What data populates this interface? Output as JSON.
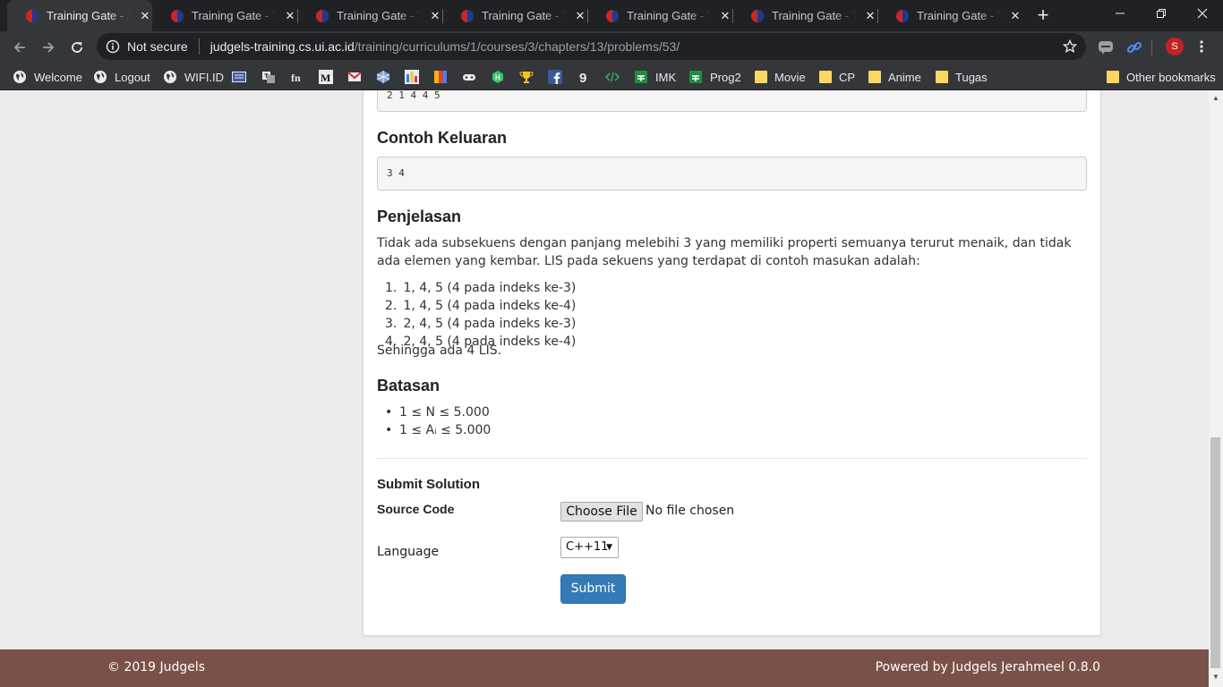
{
  "browser": {
    "tabs": [
      {
        "title": "Training Gate - Training Gate"
      },
      {
        "title": "Training Gate - Training Gate"
      },
      {
        "title": "Training Gate - Training Gate"
      },
      {
        "title": "Training Gate - Training Gate"
      },
      {
        "title": "Training Gate - Training Gate"
      },
      {
        "title": "Training Gate - Training Gate"
      },
      {
        "title": "Training Gate - Training Gate"
      }
    ],
    "address": {
      "security": "Not secure",
      "host": "judgels-training.cs.ui.ac.id",
      "path": "/training/curriculums/1/courses/3/chapters/13/problems/53/"
    },
    "profile_initial": "S",
    "bookmarks": [
      {
        "label": "Welcome",
        "icon": "globe-icon"
      },
      {
        "label": "Logout",
        "icon": "globe-icon"
      },
      {
        "label": "WIFI.ID",
        "icon": "globe-icon"
      },
      {
        "label": "IMK",
        "icon": "sheets-icon"
      },
      {
        "label": "Prog2",
        "icon": "sheets-icon"
      },
      {
        "label": "Movie",
        "icon": "folder-icon"
      },
      {
        "label": "CP",
        "icon": "folder-icon"
      },
      {
        "label": "Anime",
        "icon": "folder-icon"
      },
      {
        "label": "Tugas",
        "icon": "folder-icon"
      },
      {
        "label": "Other bookmarks",
        "icon": "folder-icon"
      }
    ]
  },
  "problem": {
    "sample_input_tail": "2 1 4 4 5",
    "sample_output_heading": "Contoh Keluaran",
    "sample_output": "3 4",
    "explanation_heading": "Penjelasan",
    "explanation_text": "Tidak ada subsekuens dengan panjang melebihi 3 yang memiliki properti semuanya terurut menaik, dan tidak ada elemen yang kembar. LIS pada sekuens yang terdapat di contoh masukan adalah:",
    "lis_list": [
      {
        "num": "1.",
        "text": "1, 4, 5 (4 pada indeks ke-3)"
      },
      {
        "num": "2.",
        "text": "1, 4, 5 (4 pada indeks ke-4)"
      },
      {
        "num": "3.",
        "text": "2, 4, 5 (4 pada indeks ke-3)"
      },
      {
        "num": "4.",
        "text": "2, 4, 5 (4 pada indeks ke-4)"
      }
    ],
    "conclusion": "Sehingga ada 4 LIS.",
    "constraints_heading": "Batasan",
    "constraints": [
      {
        "text": "1 ≤ N ≤ 5.000"
      },
      {
        "text": "1 ≤ Aᵢ ≤ 5.000"
      }
    ]
  },
  "submit": {
    "heading": "Submit Solution",
    "source_label": "Source Code",
    "file_button": "Choose File",
    "file_status": "No file chosen",
    "language_label": "Language",
    "language_value": "C++11",
    "submit_label": "Submit"
  },
  "footer": {
    "copyright": "© 2019 Judgels",
    "powered": "Powered by Judgels Jerahmeel 0.8.0"
  },
  "colors": {
    "footer": "#7a5148",
    "submit_button": "#337ab7",
    "browser_dark": "#202124",
    "toolbar": "#35363a"
  }
}
